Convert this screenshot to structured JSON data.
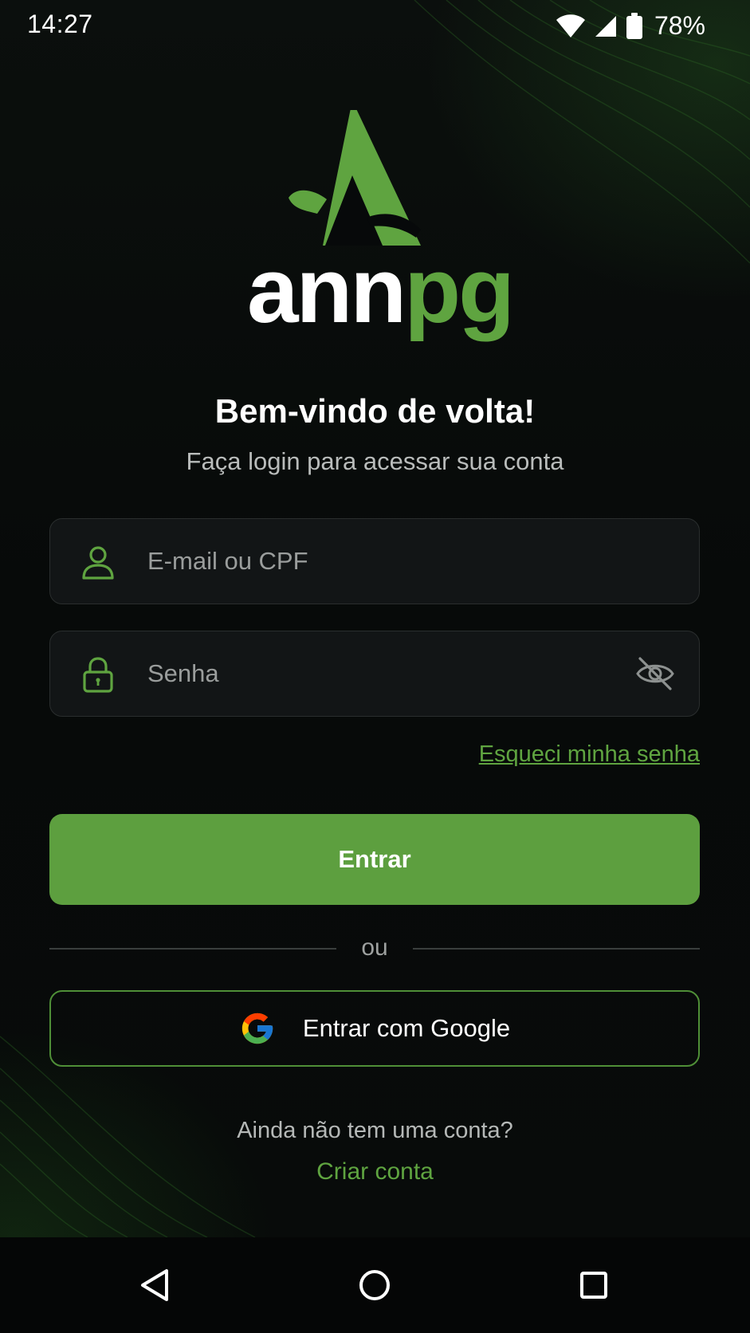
{
  "status_bar": {
    "time": "14:27",
    "battery": "78%",
    "icons": [
      "wifi-icon",
      "cellular-signal-icon",
      "battery-icon"
    ]
  },
  "logo": {
    "word_white": "ann",
    "word_green": "pg",
    "mark": "triangle-a-mark"
  },
  "header": {
    "title": "Bem-vindo de volta!",
    "subtitle": "Faça login para acessar sua conta"
  },
  "form": {
    "email_placeholder": "E-mail ou CPF",
    "email_value": "",
    "email_icon": "user-icon",
    "password_placeholder": "Senha",
    "password_value": "",
    "password_icon": "lock-icon",
    "password_toggle_icon": "eye-off-icon",
    "forgot_label": "Esqueci minha senha",
    "submit_label": "Entrar"
  },
  "divider": {
    "label": "ou"
  },
  "google": {
    "label": "Entrar com Google",
    "icon": "google-icon"
  },
  "signup": {
    "prompt": "Ainda não tem uma conta?",
    "link_label": "Criar conta"
  },
  "nav_bar": {
    "buttons": [
      "back-icon",
      "home-icon",
      "recents-icon"
    ]
  },
  "colors": {
    "accent": "#5fa440",
    "button": "#5d9f3f",
    "background": "#07090a",
    "field_bg": "#121516"
  }
}
